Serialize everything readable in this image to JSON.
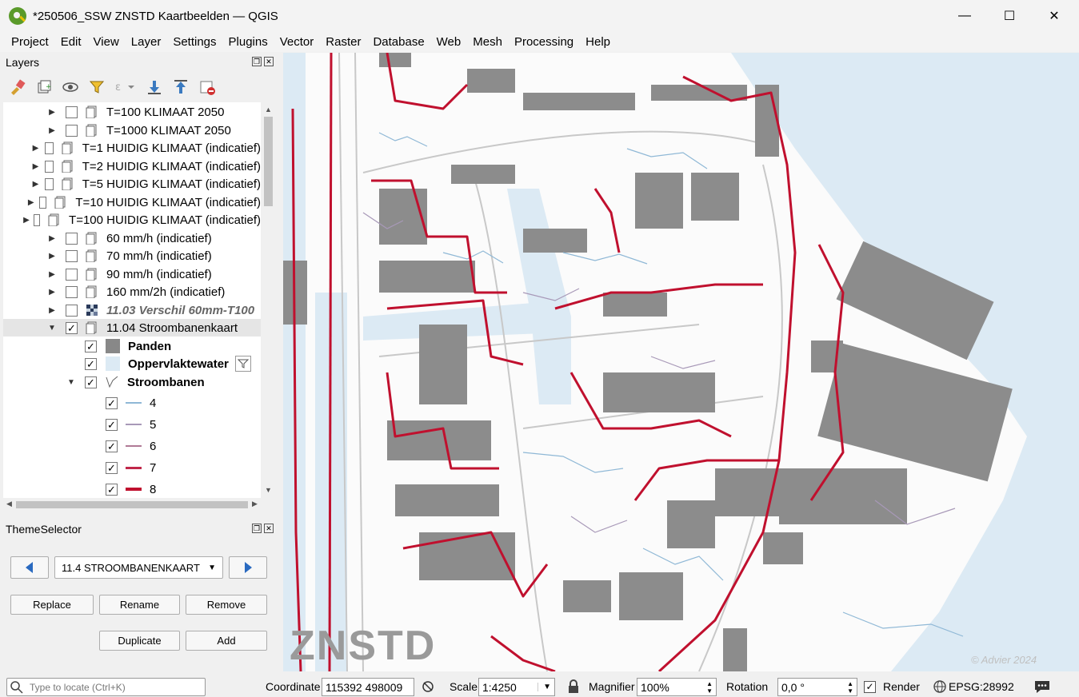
{
  "window": {
    "title": "*250506_SSW ZNSTD Kaartbeelden — QGIS",
    "minimize": "—",
    "maximize": "☐",
    "close": "✕"
  },
  "menu": [
    "Project",
    "Edit",
    "View",
    "Layer",
    "Settings",
    "Plugins",
    "Vector",
    "Raster",
    "Database",
    "Web",
    "Mesh",
    "Processing",
    "Help"
  ],
  "layers_panel": {
    "title": "Layers",
    "layers": [
      {
        "label": "T=100 KLIMAAT 2050"
      },
      {
        "label": "T=1000 KLIMAAT 2050"
      },
      {
        "label": "T=1 HUIDIG KLIMAAT (indicatief)"
      },
      {
        "label": "T=2 HUIDIG KLIMAAT (indicatief)"
      },
      {
        "label": "T=5 HUIDIG KLIMAAT (indicatief)"
      },
      {
        "label": "T=10 HUIDIG KLIMAAT (indicatief)"
      },
      {
        "label": "T=100 HUIDIG KLIMAAT (indicatief)"
      },
      {
        "label": "60 mm/h (indicatief)"
      },
      {
        "label": "70 mm/h (indicatief)"
      },
      {
        "label": "90 mm/h (indicatief)"
      },
      {
        "label": "160 mm/2h (indicatief)"
      },
      {
        "label": "11.03 Verschil 60mm-T100"
      },
      {
        "label": "11.04 Stroombanenkaart"
      }
    ],
    "sublayers": [
      {
        "label": "Panden",
        "color": "#888888"
      },
      {
        "label": "Oppervlaktewater",
        "color": "#dceaf4"
      },
      {
        "label": "Stroombanen"
      }
    ],
    "legend": [
      {
        "label": "4",
        "color": "#8fb8d6"
      },
      {
        "label": "5",
        "color": "#a899b8"
      },
      {
        "label": "6",
        "color": "#b07a96"
      },
      {
        "label": "7",
        "color": "#c0284a"
      },
      {
        "label": "8",
        "color": "#c0102e"
      }
    ]
  },
  "theme_panel": {
    "title": "ThemeSelector",
    "selected_theme": "11.4 STROOMBANENKAART",
    "buttons": {
      "replace": "Replace",
      "rename": "Rename",
      "remove": "Remove",
      "duplicate": "Duplicate",
      "add": "Add"
    }
  },
  "map": {
    "watermark": "ZNSTD",
    "credit": "© Advier 2024",
    "colors": {
      "water": "#dceaf4",
      "building": "#8c8c8c",
      "flow_major": "#b8102e",
      "flow_minor": "#8fb8d6"
    }
  },
  "status": {
    "locate_placeholder": "Type to locate (Ctrl+K)",
    "coordinate_label": "Coordinate",
    "coordinate_value": "115392  498009",
    "scale_label": "Scale",
    "scale_value": "1:4250",
    "magnifier_label": "Magnifier",
    "magnifier_value": "100%",
    "rotation_label": "Rotation",
    "rotation_value": "0,0 °",
    "render_label": "Render",
    "crs": "EPSG:28992"
  }
}
